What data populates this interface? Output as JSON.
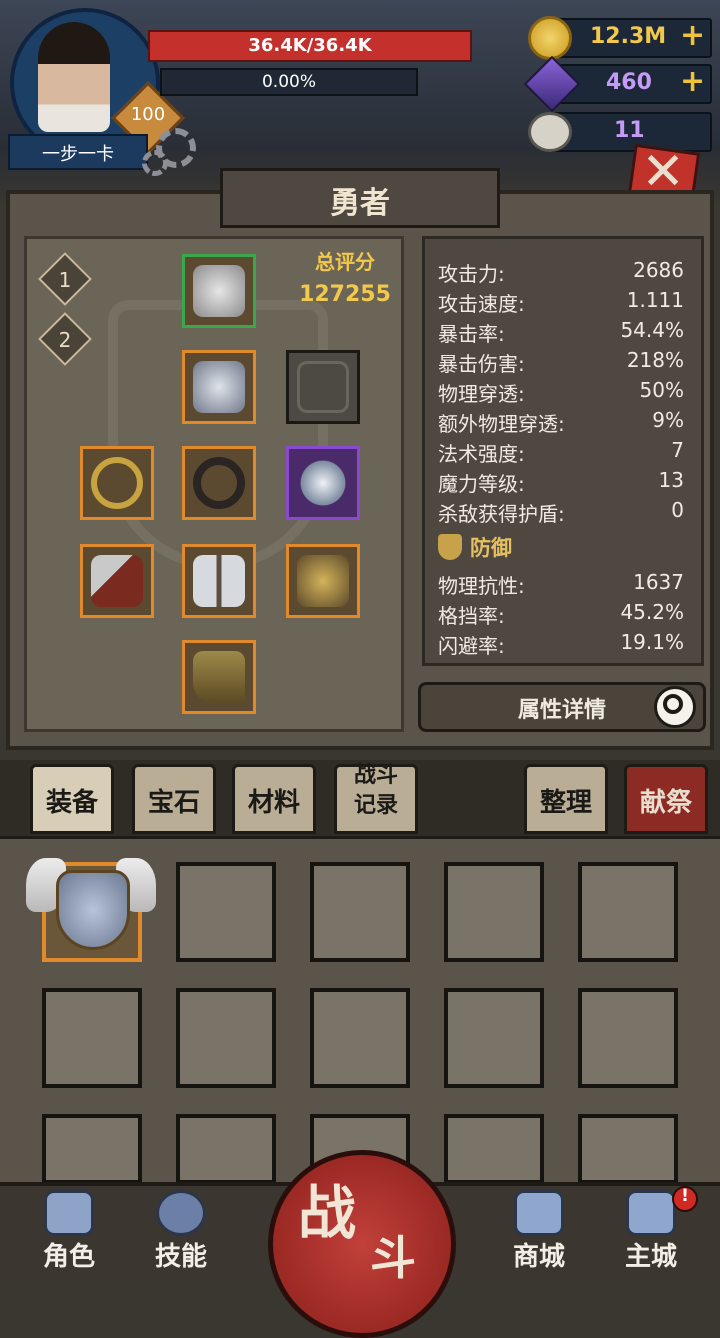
{
  "player": {
    "name": "一步一卡",
    "level": "100",
    "hp": "36.4K/36.4K",
    "hp_fraction": 1.0,
    "xp": "0.00%",
    "xp_fraction": 0.0
  },
  "resources": {
    "gold": "12.3M",
    "gems": "460",
    "skulls": "11",
    "gold_icon": "coin-icon",
    "gem_icon": "crystal-icon",
    "skull_icon": "ram-skull-icon"
  },
  "panel": {
    "title": "勇者",
    "preset_1": "1",
    "preset_2": "2",
    "score_label": "总评分",
    "score_value": "127255"
  },
  "equipment_slots": [
    {
      "name": "helmet-slot",
      "icon": "spartan-helmet-icon",
      "rarity": "green"
    },
    {
      "name": "chest-slot",
      "icon": "plate-armor-icon",
      "rarity": "orange"
    },
    {
      "name": "locked-slot",
      "icon": "locked-slot-icon",
      "rarity": "empty"
    },
    {
      "name": "weapon-left-slot",
      "icon": "serpent-bow-icon",
      "rarity": "orange"
    },
    {
      "name": "belt-slot",
      "icon": "chain-belt-icon",
      "rarity": "orange"
    },
    {
      "name": "necklace-slot",
      "icon": "snowflake-necklace-icon",
      "rarity": "purple"
    },
    {
      "name": "axe-slot",
      "icon": "axe-icon",
      "rarity": "orange"
    },
    {
      "name": "legs-slot",
      "icon": "leg-armor-icon",
      "rarity": "orange"
    },
    {
      "name": "gloves-slot",
      "icon": "gauntlet-icon",
      "rarity": "orange"
    },
    {
      "name": "boots-slot",
      "icon": "boots-icon",
      "rarity": "orange"
    }
  ],
  "stats": [
    {
      "label": "攻击力:",
      "value": "2686"
    },
    {
      "label": "攻击速度:",
      "value": "1.111"
    },
    {
      "label": "暴击率:",
      "value": "54.4%"
    },
    {
      "label": "暴击伤害:",
      "value": "218%"
    },
    {
      "label": "物理穿透:",
      "value": "50%"
    },
    {
      "label": "额外物理穿透:",
      "value": "9%"
    },
    {
      "label": "法术强度:",
      "value": "7"
    },
    {
      "label": "魔力等级:",
      "value": "13"
    },
    {
      "label": "杀敌获得护盾:",
      "value": "0"
    }
  ],
  "defense": {
    "title": "防御",
    "stats": [
      {
        "label": "物理抗性:",
        "value": "1637"
      },
      {
        "label": "格挡率:",
        "value": "45.2%"
      },
      {
        "label": "闪避率:",
        "value": "19.1%"
      }
    ]
  },
  "detail_button": "属性详情",
  "tabs": {
    "equip": "装备",
    "gems": "宝石",
    "materials": "材料",
    "battle_log_1": "战斗",
    "battle_log_2": "记录",
    "sort": "整理",
    "sacrifice": "献祭"
  },
  "nav": {
    "character": "角色",
    "skills": "技能",
    "fight_1": "战",
    "fight_2": "斗",
    "shop": "商城",
    "city": "主城",
    "alert": "!"
  },
  "colors": {
    "accent_gold": "#f2c94c",
    "hp_red": "#c4302b",
    "rarity_orange": "#e08a2c",
    "rarity_purple": "#8a4ad0",
    "rarity_green": "#3aa84a"
  }
}
